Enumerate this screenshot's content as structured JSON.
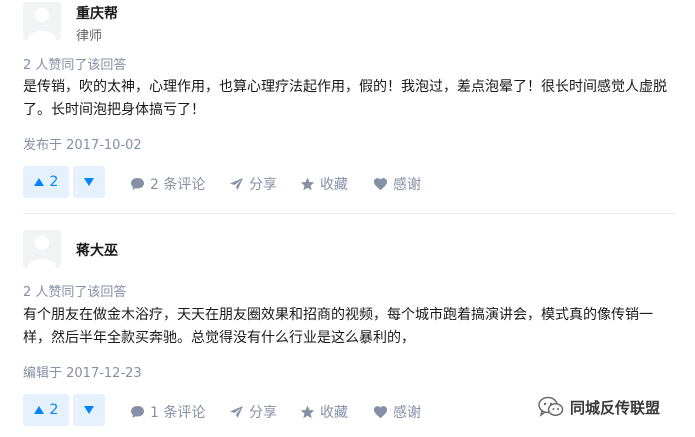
{
  "answers": [
    {
      "author": "重庆帮",
      "title": "律师",
      "upvote_note": "2 人赞同了该回答",
      "content": "是传销，吹的太神，心理作用，也算心理疗法起作用，假的！我泡过，差点泡晕了！很长时间感觉人虚脱了。长时间泡把身体搞亏了！",
      "date": "发布于 2017-10-02",
      "vote_count": "2",
      "comments": "2 条评论",
      "share": "分享",
      "collect": "收藏",
      "thanks": "感谢"
    },
    {
      "author": "蒋大巫",
      "title": "",
      "upvote_note": "2 人赞同了该回答",
      "content": "有个朋友在做金木浴疗，天天在朋友圈效果和招商的视频，每个城市跑着搞演讲会，模式真的像传销一样，然后半年全款买奔驰。总觉得没有什么行业是这么暴利的，",
      "date": "编辑于 2017-12-23",
      "vote_count": "2",
      "comments": "1 条评论",
      "share": "分享",
      "collect": "收藏",
      "thanks": "感谢"
    }
  ],
  "watermark": {
    "text": "同城反传联盟"
  },
  "icons": {
    "upvote": "triangle-up-icon",
    "downvote": "triangle-down-icon",
    "comment": "comment-bubble-icon",
    "share": "paper-plane-icon",
    "collect": "star-icon",
    "thanks": "heart-icon",
    "avatar": "default-avatar-icon",
    "watermark": "wechat-icon"
  },
  "colors": {
    "accent": "#0084ff",
    "vote_bg": "#e5f1fd",
    "meta_text": "#8590a6",
    "divider": "#ebebeb"
  }
}
